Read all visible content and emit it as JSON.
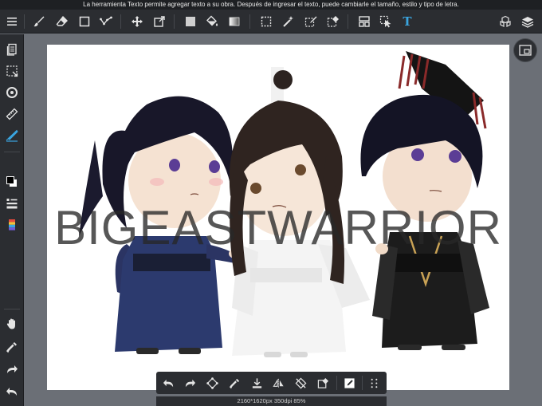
{
  "hint_text": "La herramienta Texto permite agregar texto a su obra. Después de ingresar el texto, puede cambiarle el tamaño, estilo y tipo de letra.",
  "toolbar": {
    "items": [
      "menu-icon",
      "brush-icon",
      "eraser-icon",
      "rectangle-icon",
      "line-icon",
      "move-icon",
      "transform-icon",
      "fill-color-icon",
      "bucket-icon",
      "gradient-icon",
      "select-rect-icon",
      "magic-wand-icon",
      "select-pen-icon",
      "select-eraser-icon",
      "panel-icon",
      "select-move-icon",
      "text-icon",
      "materials-icon",
      "layers-icon"
    ],
    "text_tool_label": "T"
  },
  "left_panel": {
    "items": [
      "pages-icon",
      "selection-icon",
      "rotate-icon",
      "ruler-icon",
      "snap-icon",
      "color-icon",
      "brush-size-icon",
      "palette-icon",
      "hand-icon",
      "eyedropper-icon",
      "redo-icon",
      "undo-icon"
    ]
  },
  "canvas": {
    "watermark": "BIGEASTWARRIOR",
    "background": "#ffffff"
  },
  "bottom_toolbar": {
    "items": [
      "undo-icon",
      "redo-icon",
      "transform-icon",
      "eyedropper-icon",
      "save-icon",
      "flip-icon",
      "rotate-lock-icon",
      "clear-icon",
      "fill-icon",
      "more-icon"
    ]
  },
  "doc_info": "2160*1620px 350dpi 85%",
  "colors": {
    "ui_dark": "#2b2d31",
    "workspace": "#6b6f76",
    "accent_blue": "#3aa5e0"
  }
}
